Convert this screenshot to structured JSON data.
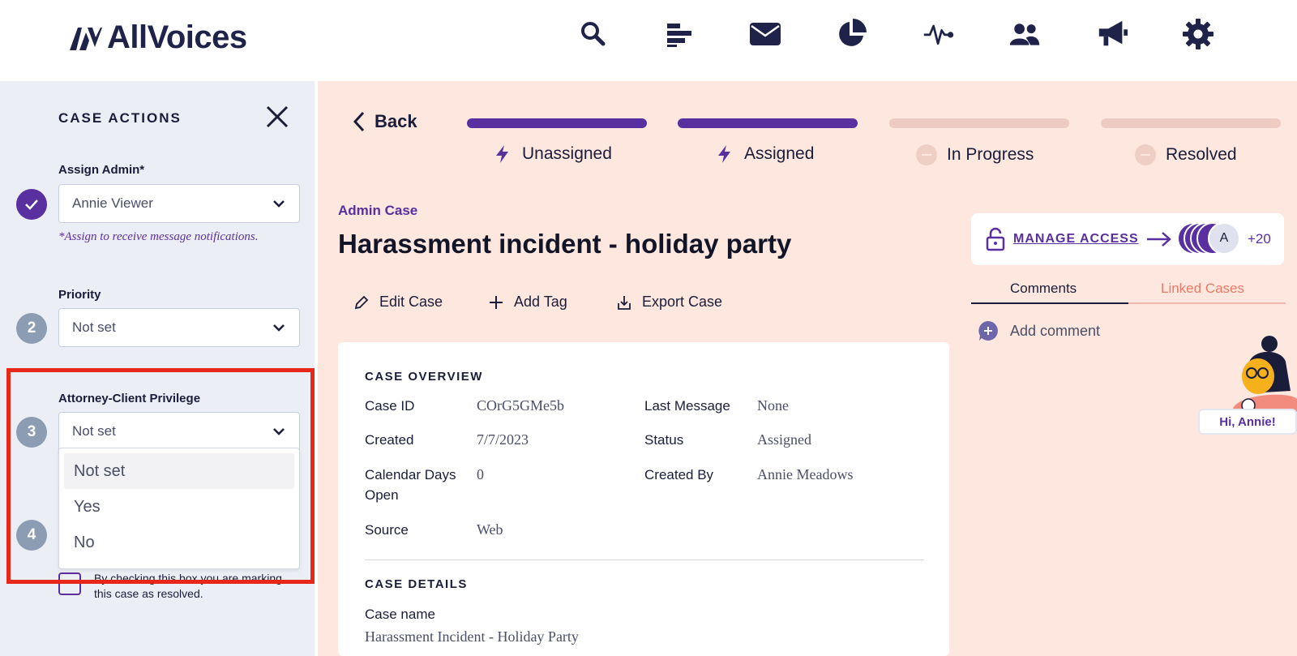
{
  "brand": {
    "name": "AllVoices"
  },
  "nav": {
    "icons": [
      "search-icon",
      "list-icon",
      "mail-icon",
      "pie-chart-icon",
      "pulse-icon",
      "users-icon",
      "megaphone-icon",
      "gear-icon"
    ]
  },
  "sidebar": {
    "title": "CASE ACTIONS",
    "assign_admin": {
      "label": "Assign Admin*",
      "value": "Annie Viewer",
      "hint": "*Assign to receive message notifications."
    },
    "priority": {
      "step": "2",
      "label": "Priority",
      "value": "Not set"
    },
    "privilege": {
      "step": "3",
      "label": "Attorney-Client Privilege",
      "value": "Not set",
      "options": [
        "Not set",
        "Yes",
        "No"
      ]
    },
    "step4": {
      "step": "4",
      "checkbox_text": "By checking this box you are marking this case as resolved."
    }
  },
  "progress": {
    "back_label": "Back",
    "stages": [
      {
        "label": "Unassigned",
        "state": "done"
      },
      {
        "label": "Assigned",
        "state": "done"
      },
      {
        "label": "In Progress",
        "state": "pending"
      },
      {
        "label": "Resolved",
        "state": "pending"
      }
    ]
  },
  "case": {
    "type": "Admin Case",
    "title": "Harassment incident - holiday party",
    "actions": {
      "edit": "Edit Case",
      "tag": "Add Tag",
      "export": "Export Case"
    },
    "overview_title": "CASE OVERVIEW",
    "overview": {
      "case_id_label": "Case ID",
      "case_id": "COrG5GMe5b",
      "created_label": "Created",
      "created": "7/7/2023",
      "days_label_1": "Calendar Days",
      "days_label_2": "Open",
      "days": "0",
      "source_label": "Source",
      "source": "Web",
      "last_msg_label": "Last Message",
      "last_msg": "None",
      "status_label": "Status",
      "status": "Assigned",
      "created_by_label": "Created By",
      "created_by": "Annie Meadows"
    },
    "details_title": "CASE DETAILS",
    "case_name_label": "Case name",
    "case_name": "Harassment Incident - Holiday Party"
  },
  "right_panel": {
    "manage_access": "MANAGE ACCESS",
    "avatar_initial": "A",
    "extra_count": "+20",
    "tabs": [
      "Comments",
      "Linked Cases"
    ],
    "add_comment": "Add comment",
    "greeting": "Hi, Annie!"
  },
  "colors": {
    "accent": "#5a2fa0",
    "main_bg": "#fde7df",
    "sidebar_bg": "#eceef5",
    "highlight": "#e8271b"
  }
}
